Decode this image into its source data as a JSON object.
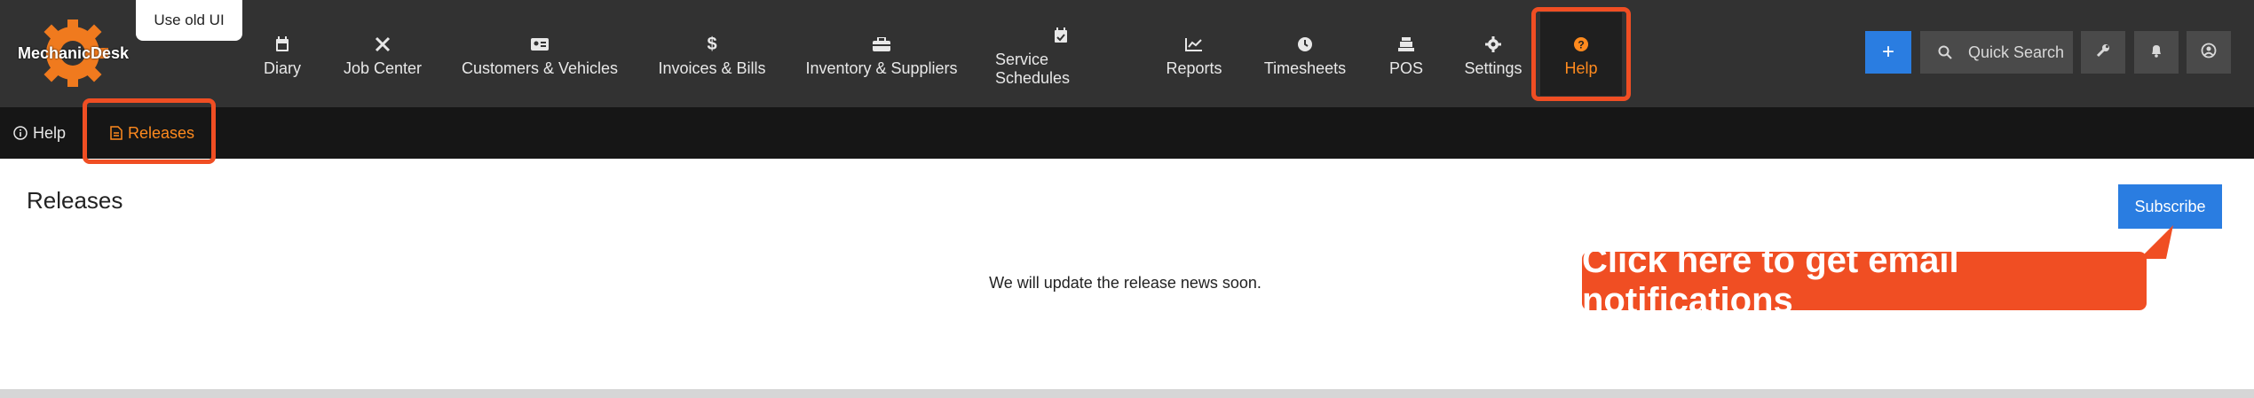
{
  "brand": {
    "name": "MechanicDesk",
    "accent": "#ff8a1e",
    "annotation_color": "#f04e23",
    "primary": "#2a7de1"
  },
  "old_ui_label": "Use old UI",
  "nav": {
    "items": [
      {
        "label": "Diary",
        "icon": "calendar-icon"
      },
      {
        "label": "Job Center",
        "icon": "tools-icon"
      },
      {
        "label": "Customers & Vehicles",
        "icon": "id-card-icon"
      },
      {
        "label": "Invoices & Bills",
        "icon": "dollar-icon"
      },
      {
        "label": "Inventory & Suppliers",
        "icon": "toolbox-icon"
      },
      {
        "label": "Service Schedules",
        "icon": "calendar-check-icon"
      },
      {
        "label": "Reports",
        "icon": "chart-line-icon"
      },
      {
        "label": "Timesheets",
        "icon": "clock-icon"
      },
      {
        "label": "POS",
        "icon": "cash-register-icon"
      },
      {
        "label": "Settings",
        "icon": "gear-icon"
      },
      {
        "label": "Help",
        "icon": "question-circle-icon",
        "active": true
      }
    ]
  },
  "actions": {
    "add_label": "+",
    "search_placeholder": "Quick Search"
  },
  "subnav": {
    "items": [
      {
        "label": "Help",
        "icon": "info-circle-icon"
      },
      {
        "label": "Releases",
        "icon": "document-icon",
        "active": true
      }
    ]
  },
  "main": {
    "title": "Releases",
    "subscribe_label": "Subscribe",
    "empty_message": "We will update the release news soon."
  },
  "annotation": {
    "text": "Click here to get email notifications"
  }
}
